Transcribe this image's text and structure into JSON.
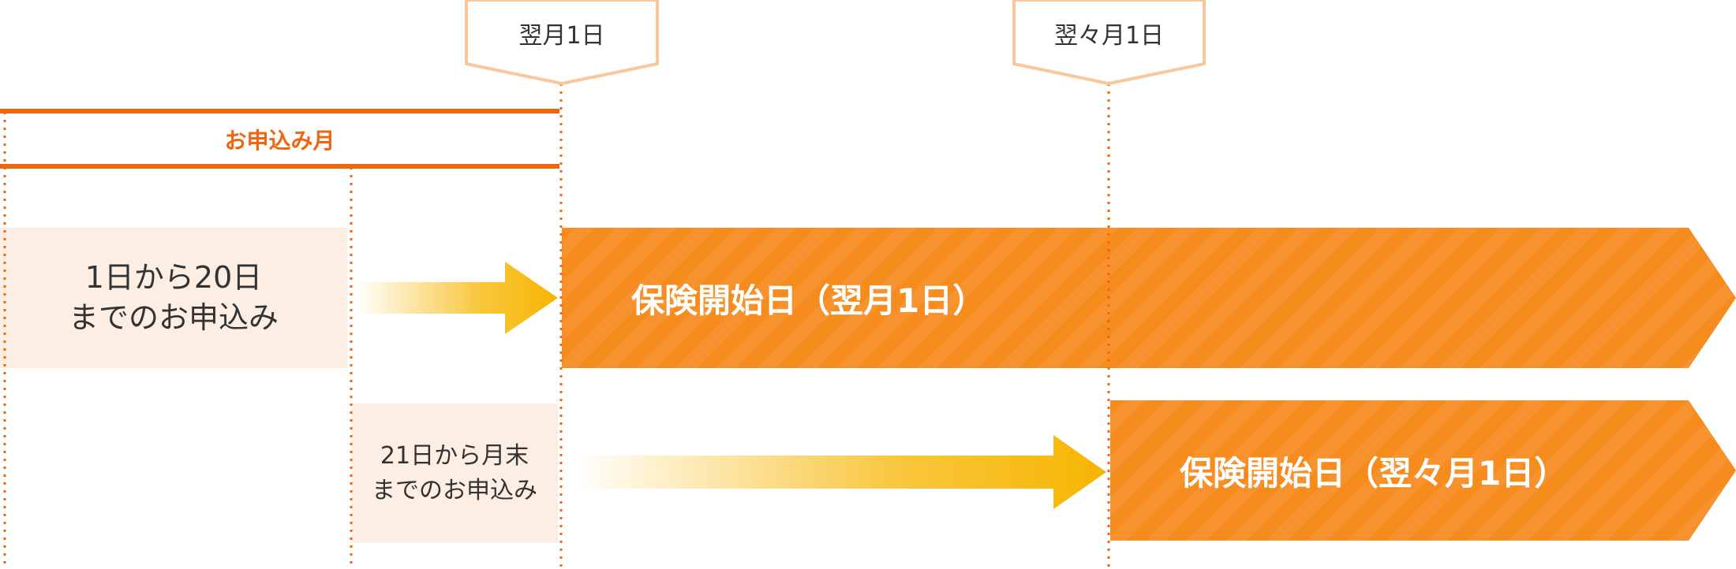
{
  "markers": {
    "next_month": "翌月1日",
    "month_after_next": "翌々月1日"
  },
  "application_month": "お申込み月",
  "cases": {
    "early": {
      "line1": "1日から20日",
      "line2": "までのお申込み"
    },
    "late": {
      "line1": "21日から月末",
      "line2": "までのお申込み"
    }
  },
  "results": {
    "early": "保険開始日（翌月1日）",
    "late": "保険開始日（翌々月1日）"
  },
  "colors": {
    "accent_orange": "#ef6510",
    "band_orange": "#f68b1e",
    "marker_border": "#f9c89a",
    "case_bg": "#fdeee3",
    "arrow_yellow": "#f7b500"
  }
}
